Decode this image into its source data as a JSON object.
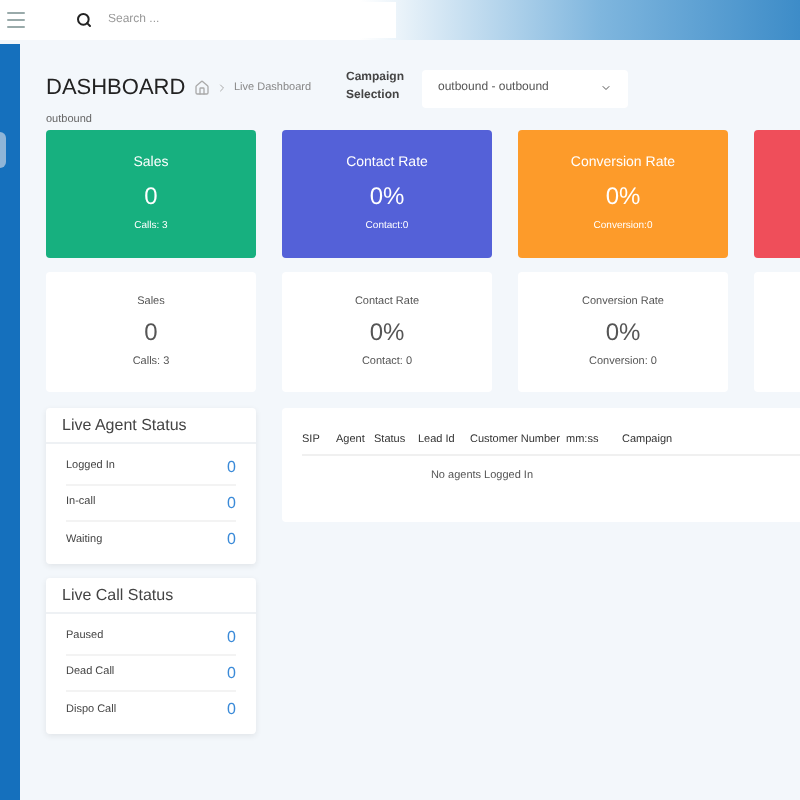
{
  "topbar": {
    "search": {
      "placeholder": "Search ..."
    }
  },
  "header": {
    "title": "DASHBOARD",
    "breadcrumb": "Live Dashboard",
    "campaign_label": "Campaign Selection",
    "campaign_value": "outbound - outbound",
    "campaign_name": "outbound"
  },
  "stat_cards": [
    {
      "title": "Sales",
      "value": "0",
      "sub": "Calls: 3",
      "color": "#17b07f"
    },
    {
      "title": "Contact Rate",
      "value": "0%",
      "sub": "Contact:0",
      "color": "#5461d8"
    },
    {
      "title": "Conversion Rate",
      "value": "0%",
      "sub": "Conversion:0",
      "color": "#fd9b2a"
    },
    {
      "color": "#ef4e5a"
    }
  ],
  "summary_cards": [
    {
      "title": "Sales",
      "value": "0",
      "sub": "Calls: 3"
    },
    {
      "title": "Contact Rate",
      "value": "0%",
      "sub": "Contact: 0"
    },
    {
      "title": "Conversion Rate",
      "value": "0%",
      "sub": "Conversion: 0"
    }
  ],
  "status_panels": [
    {
      "title": "Live Agent Status",
      "rows": [
        {
          "label": "Logged In",
          "value": "0"
        },
        {
          "label": "In-call",
          "value": "0"
        },
        {
          "label": "Waiting",
          "value": "0"
        }
      ]
    },
    {
      "title": "Live Call Status",
      "rows": [
        {
          "label": "Paused",
          "value": "0"
        },
        {
          "label": "Dead Call",
          "value": "0"
        },
        {
          "label": "Dispo Call",
          "value": "0"
        }
      ]
    }
  ],
  "agents_table": {
    "columns": [
      "SIP",
      "Agent",
      "Status",
      "Lead Id",
      "Customer Number",
      "mm:ss",
      "Campaign"
    ],
    "empty_message": "No agents Logged In"
  }
}
